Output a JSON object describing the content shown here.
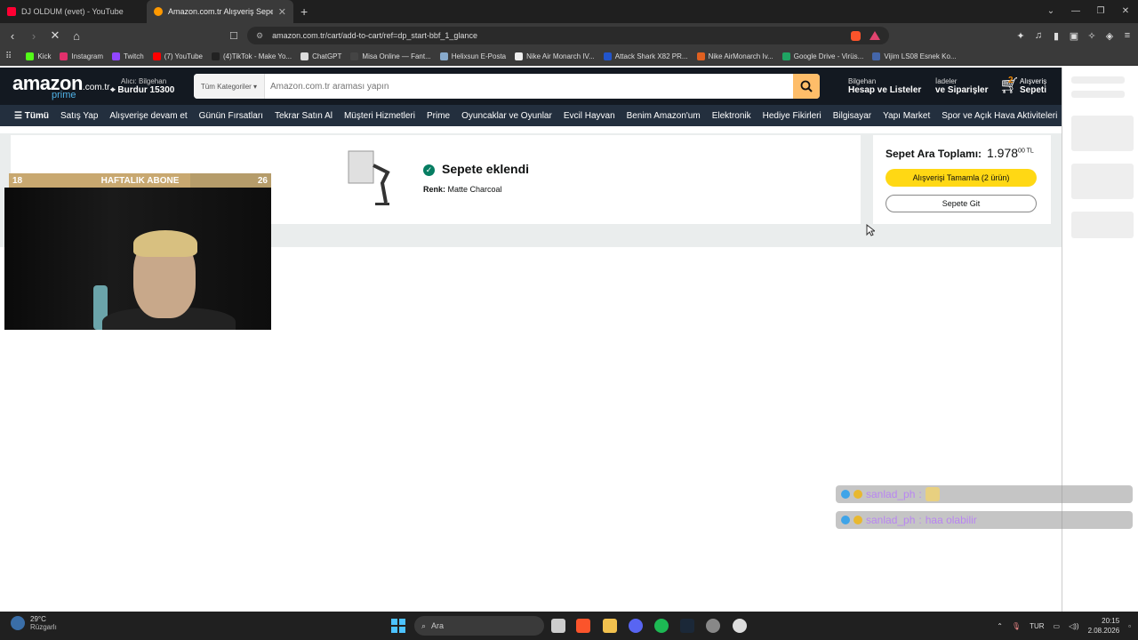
{
  "browser": {
    "tabs": [
      {
        "title": "DJ OLDUM (evet) - YouTube",
        "color": "#ff0033"
      },
      {
        "title": "Amazon.com.tr Alışveriş Sepeti",
        "color": "#ff9900"
      }
    ],
    "new_tab": "+",
    "url": "amazon.com.tr/cart/add-to-cart/ref=dp_start-bbf_1_glance",
    "bookmarks": [
      {
        "label": "Kick",
        "color": "#53fc18"
      },
      {
        "label": "Instagram",
        "color": "#e1306c"
      },
      {
        "label": "Twitch",
        "color": "#9146ff"
      },
      {
        "label": "(7) YouTube",
        "color": "#ff0000"
      },
      {
        "label": "(4)TikTok - Make Yo...",
        "color": "#222222"
      },
      {
        "label": "ChatGPT",
        "color": "#dddddd"
      },
      {
        "label": "Misa Online — Fant...",
        "color": "#444444"
      },
      {
        "label": "Helixsun E-Posta",
        "color": "#88aacc"
      },
      {
        "label": "Nike Air Monarch IV...",
        "color": "#eeeeee"
      },
      {
        "label": "Attack Shark X82 PR...",
        "color": "#2255cc"
      },
      {
        "label": "Nike AirMonarch Iv...",
        "color": "#e06020"
      },
      {
        "label": "Google Drive - Virüs...",
        "color": "#1fa463"
      },
      {
        "label": "Vijim LS08 Esnek Ko...",
        "color": "#4466aa"
      }
    ]
  },
  "amazon": {
    "logo": "amazon",
    "logo_tld": ".com.tr",
    "logo_prime": "prime",
    "deliver_l1": "Alıcı: Bilgehan",
    "deliver_l2": "Burdur 15300",
    "search_category": "Tüm Kategoriler",
    "search_placeholder": "Amazon.com.tr araması yapın",
    "account_l1": "Bilgehan",
    "account_l2": "Hesap ve Listeler",
    "orders_l1": "İadeler",
    "orders_l2": "ve Siparişler",
    "cart_count": "2",
    "cart_l1": "Alışveriş",
    "cart_l2": "Sepeti",
    "nav": [
      "Tümü",
      "Satış Yap",
      "Alışverişe devam et",
      "Günün Fırsatları",
      "Tekrar Satın Al",
      "Müşteri Hizmetleri",
      "Prime",
      "Oyuncaklar ve Oyunlar",
      "Evcil Hayvan",
      "Benim Amazon'um",
      "Elektronik",
      "Hediye Fikirleri",
      "Bilgisayar",
      "Yapı Market",
      "Spor ve Açık Hava Aktiviteleri"
    ]
  },
  "cart": {
    "added_title": "Sepete eklendi",
    "color_label": "Renk:",
    "color_value": "Matte Charcoal",
    "subtotal_label": "Sepet Ara Toplamı:",
    "subtotal_main": "1.978",
    "subtotal_sup": "00 TL",
    "checkout_button": "Alışverişi Tamamla (2 ürün)",
    "go_cart_button": "Sepete Git"
  },
  "overlay": {
    "sub_left": "18",
    "sub_title": "HAFTALIK ABONE",
    "sub_right": "26",
    "sub_progress": 0.69,
    "chat": [
      {
        "user": "sanlad_ph",
        "sep": ":",
        "text": ""
      },
      {
        "user": "sanlad_ph",
        "sep": ":",
        "text": "haa olabilir"
      }
    ]
  },
  "taskbar": {
    "temp": "29°C",
    "weather": "Rüzgarlı",
    "search": "Ara",
    "lang": "TUR",
    "time": "20:15",
    "date": "2.08.2026"
  }
}
